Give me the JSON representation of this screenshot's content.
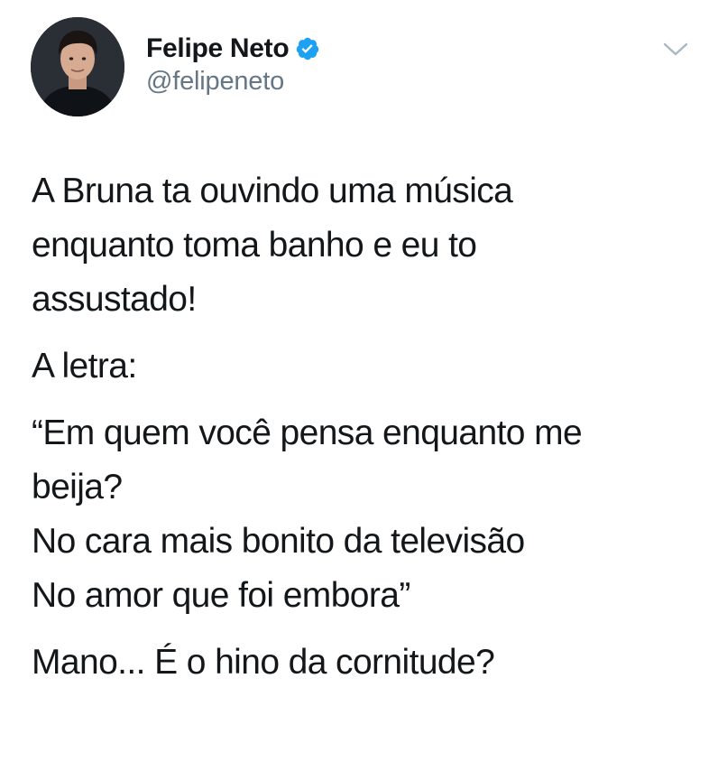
{
  "tweet": {
    "author": {
      "display_name": "Felipe Neto",
      "handle": "@felipeneto",
      "verified": true,
      "verified_color": "#1da1f2",
      "avatar_icon": "profile-photo"
    },
    "menu_icon": "chevron-down-icon",
    "paragraphs": [
      {
        "lines": [
          "A Bruna ta ouvindo uma música",
          "enquanto toma banho e eu to",
          "assustado!"
        ]
      },
      {
        "lines": [
          "A letra:"
        ]
      },
      {
        "lines": [
          "“Em quem você pensa enquanto me",
          "beija?",
          "No cara mais bonito da televisão",
          "No amor que foi embora”"
        ]
      },
      {
        "lines": [
          "Mano... É o hino da cornitude?"
        ]
      }
    ]
  },
  "colors": {
    "text": "#14171a",
    "secondary_text": "#657786",
    "accent": "#1da1f2",
    "background": "#ffffff"
  }
}
